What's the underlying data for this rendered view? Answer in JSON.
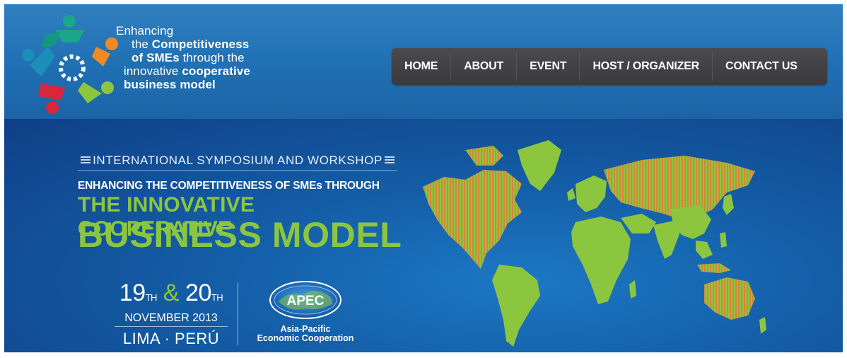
{
  "header": {
    "tagline": {
      "line1": "Enhancing",
      "line2_prefix": "the ",
      "line2_bold": "Competitiveness",
      "line3_bold": "of SMEs",
      "line3_suffix": " through the",
      "line4_prefix": "innovative ",
      "line4_bold": "cooperative",
      "line5_bold": "business model"
    }
  },
  "nav": {
    "items": [
      {
        "label": "HOME"
      },
      {
        "label": "ABOUT"
      },
      {
        "label": "EVENT"
      },
      {
        "label": "HOST / ORGANIZER"
      },
      {
        "label": "CONTACT US"
      }
    ]
  },
  "banner": {
    "event_type": "INTERNATIONAL SYMPOSIUM AND WORKSHOP",
    "subtitle": "ENHANCING THE COMPETITIVENESS OF SMEs THROUGH",
    "headline1": "THE INNOVATIVE COOPERATIVE",
    "headline2": "BUSINESS MODEL",
    "date_day1": "19",
    "date_ord1": "TH",
    "date_amp": " & ",
    "date_day2": "20",
    "date_ord2": "TH",
    "month": "NOVEMBER 2013",
    "location": "LIMA · PERÚ",
    "apec_logo_text": "APEC",
    "apec_name_line1": "Asia-Pacific",
    "apec_name_line2": "Economic Cooperation"
  },
  "colors": {
    "header_blue": "#1f6fb3",
    "nav_bg": "#3f3f44",
    "accent_green": "#8cc63f",
    "banner_dark": "#0f3f86",
    "map_stripe_orange": "#d7863a"
  }
}
